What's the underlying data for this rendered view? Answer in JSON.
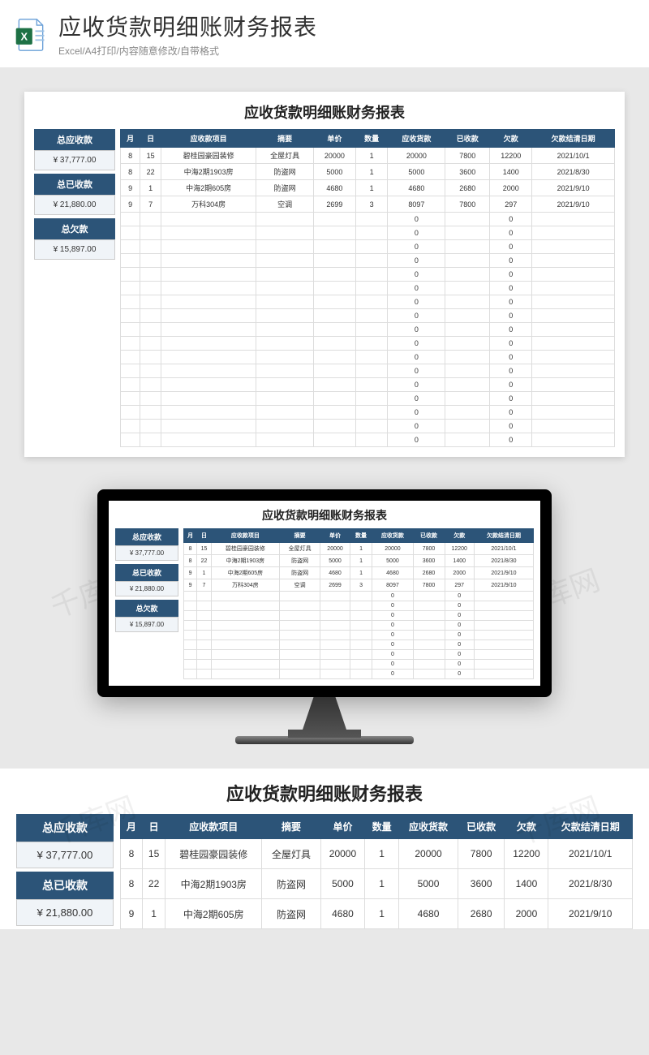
{
  "header": {
    "title": "应收货款明细账财务报表",
    "subtitle": "Excel/A4打印/内容随意修改/自带格式",
    "icon": "excel-file-icon"
  },
  "watermark_text": "千库网",
  "sheet": {
    "title": "应收货款明细账财务报表",
    "summary": [
      {
        "label": "总应收款",
        "value": "¥   37,777.00"
      },
      {
        "label": "总已收款",
        "value": "¥   21,880.00"
      },
      {
        "label": "总欠款",
        "value": "¥   15,897.00"
      }
    ],
    "columns": [
      "月",
      "日",
      "应收款项目",
      "摘要",
      "单价",
      "数量",
      "应收货款",
      "已收款",
      "欠款",
      "欠款结清日期"
    ],
    "rows": [
      {
        "month": "8",
        "day": "15",
        "project": "碧桂园豪园装修",
        "summary": "全屋灯具",
        "price": "20000",
        "qty": "1",
        "receivable": "20000",
        "received": "7800",
        "owed": "12200",
        "clear_date": "2021/10/1"
      },
      {
        "month": "8",
        "day": "22",
        "project": "中海2期1903房",
        "summary": "防盗网",
        "price": "5000",
        "qty": "1",
        "receivable": "5000",
        "received": "3600",
        "owed": "1400",
        "clear_date": "2021/8/30"
      },
      {
        "month": "9",
        "day": "1",
        "project": "中海2期605房",
        "summary": "防盗网",
        "price": "4680",
        "qty": "1",
        "receivable": "4680",
        "received": "2680",
        "owed": "2000",
        "clear_date": "2021/9/10"
      },
      {
        "month": "9",
        "day": "7",
        "project": "万科304房",
        "summary": "空调",
        "price": "2699",
        "qty": "3",
        "receivable": "8097",
        "received": "7800",
        "owed": "297",
        "clear_date": "2021/9/10"
      }
    ],
    "empty_row": {
      "receivable": "0",
      "owed": "0"
    },
    "empty_row_count": 17
  },
  "monitor_empty_rows": 9,
  "bottom_crop_rows": 3
}
